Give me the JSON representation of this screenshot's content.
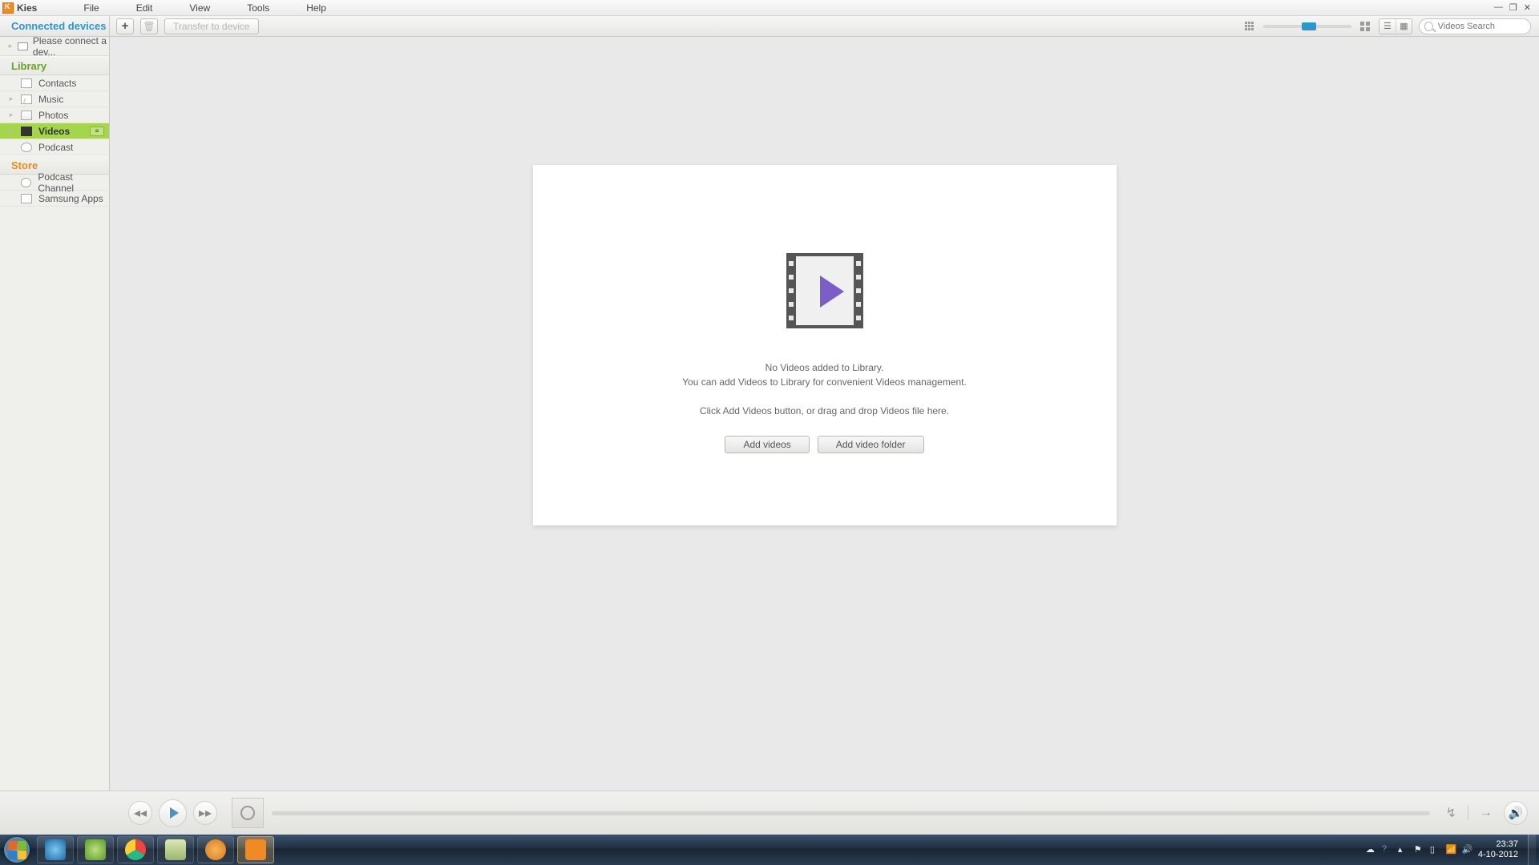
{
  "app": {
    "name": "Kies"
  },
  "menu": {
    "file": "File",
    "edit": "Edit",
    "view": "View",
    "tools": "Tools",
    "help": "Help"
  },
  "toolbar": {
    "left_label": "Connected devices",
    "transfer_label": "Transfer to device",
    "search_placeholder": "Videos Search"
  },
  "sidebar": {
    "device_prompt": "Please connect a dev...",
    "library_label": "Library",
    "store_label": "Store",
    "lib": {
      "contacts": "Contacts",
      "music": "Music",
      "photos": "Photos",
      "videos": "Videos",
      "podcast": "Podcast"
    },
    "store": {
      "podcast_channel": "Podcast Channel",
      "samsung_apps": "Samsung Apps"
    }
  },
  "empty": {
    "line1": "No Videos added to Library.",
    "line2": "You can add Videos to Library for convenient Videos management.",
    "line3": "Click Add Videos button, or drag and drop Videos file here.",
    "add_videos": "Add videos",
    "add_folder": "Add video folder"
  },
  "systray": {
    "time": "23:37",
    "date": "4-10-2012"
  }
}
